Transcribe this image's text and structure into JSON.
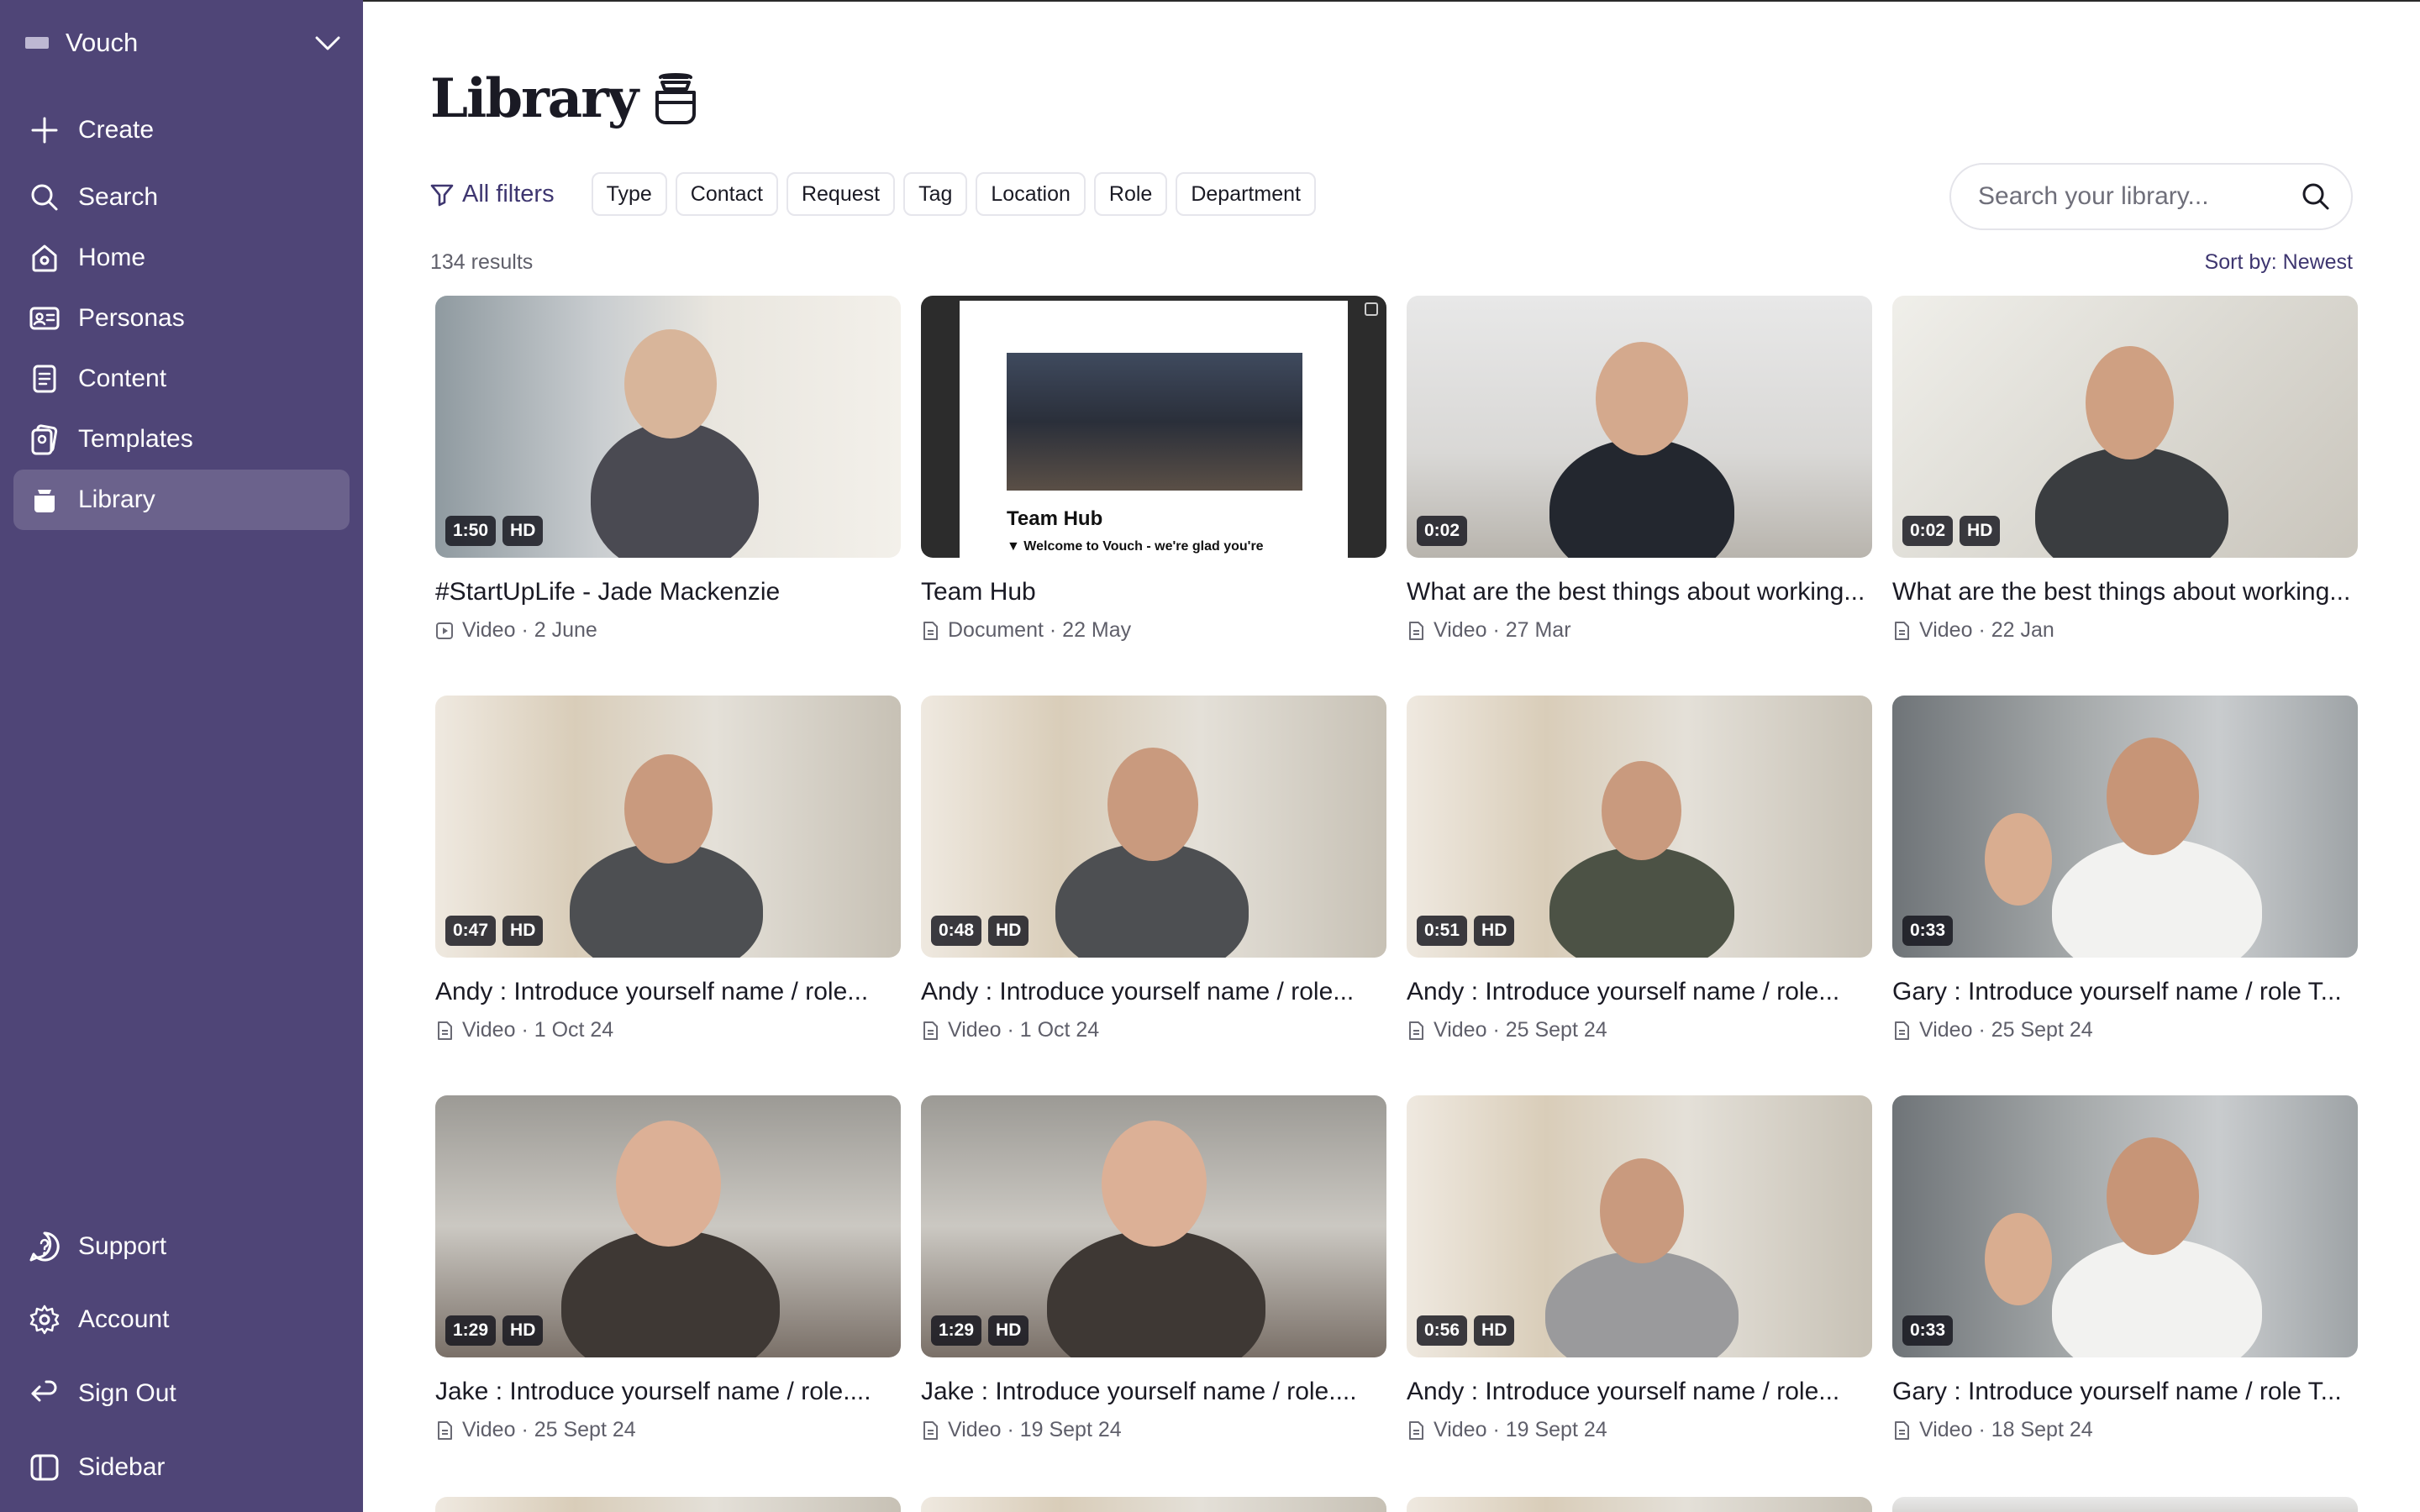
{
  "sidebar": {
    "workspace": {
      "name": "Vouch"
    },
    "nav": [
      {
        "label": "Create",
        "icon": "plus-icon"
      },
      {
        "label": "Search",
        "icon": "search-icon"
      },
      {
        "label": "Home",
        "icon": "home-icon"
      },
      {
        "label": "Personas",
        "icon": "id-card-icon"
      },
      {
        "label": "Content",
        "icon": "document-icon"
      },
      {
        "label": "Templates",
        "icon": "templates-icon"
      },
      {
        "label": "Library",
        "icon": "library-icon",
        "active": true
      }
    ],
    "footer": [
      {
        "label": "Support",
        "icon": "help-icon"
      },
      {
        "label": "Account",
        "icon": "gear-icon"
      },
      {
        "label": "Sign Out",
        "icon": "sign-out-icon"
      },
      {
        "label": "Sidebar",
        "icon": "sidebar-toggle-icon"
      }
    ]
  },
  "header": {
    "title": "Library",
    "search_placeholder": "Search your library...",
    "all_filters": "All filters",
    "filters": [
      "Type",
      "Contact",
      "Request",
      "Tag",
      "Location",
      "Role",
      "Department"
    ],
    "results": "134 results",
    "sort": "Sort by: Newest"
  },
  "items": [
    {
      "title": "#StartUpLife - Jade Mackenzie",
      "type": "Video",
      "date": "2 June",
      "duration": "1:50",
      "hd": "HD"
    },
    {
      "title": "Team Hub",
      "type": "Document",
      "date": "22 May",
      "duration": "",
      "hd": "",
      "doc_title": "Team Hub",
      "doc_sub": "▼ Welcome to Vouch - we're glad you're"
    },
    {
      "title": "What are the best things about working...",
      "type": "Video",
      "date": "27 Mar",
      "duration": "0:02",
      "hd": ""
    },
    {
      "title": "What are the best things about working...",
      "type": "Video",
      "date": "22 Jan",
      "duration": "0:02",
      "hd": "HD"
    },
    {
      "title": "Andy : Introduce yourself name / role...",
      "type": "Video",
      "date": "1 Oct 24",
      "duration": "0:47",
      "hd": "HD"
    },
    {
      "title": "Andy : Introduce yourself name / role...",
      "type": "Video",
      "date": "1 Oct 24",
      "duration": "0:48",
      "hd": "HD"
    },
    {
      "title": "Andy : Introduce yourself name / role...",
      "type": "Video",
      "date": "25 Sept 24",
      "duration": "0:51",
      "hd": "HD"
    },
    {
      "title": "Gary : Introduce yourself name / role T...",
      "type": "Video",
      "date": "25 Sept 24",
      "duration": "0:33",
      "hd": ""
    },
    {
      "title": "Jake : Introduce yourself name / role....",
      "type": "Video",
      "date": "25 Sept 24",
      "duration": "1:29",
      "hd": "HD"
    },
    {
      "title": "Jake : Introduce yourself name / role....",
      "type": "Video",
      "date": "19 Sept 24",
      "duration": "1:29",
      "hd": "HD"
    },
    {
      "title": "Andy : Introduce yourself name / role...",
      "type": "Video",
      "date": "19 Sept 24",
      "duration": "0:56",
      "hd": "HD"
    },
    {
      "title": "Gary : Introduce yourself name / role T...",
      "type": "Video",
      "date": "18 Sept 24",
      "duration": "0:33",
      "hd": ""
    }
  ]
}
